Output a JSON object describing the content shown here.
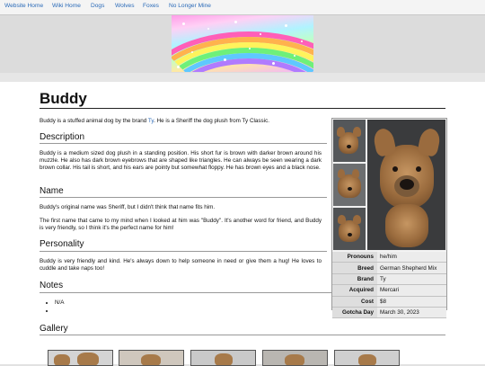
{
  "nav": {
    "items": [
      "Website Home",
      "Wiki Home",
      "Dogs",
      "Wolves",
      "Foxes",
      "No Longer Mine"
    ]
  },
  "page": {
    "title": "Buddy",
    "intro_before": "Buddy is a stuffed animal dog by the brand ",
    "intro_link": "Ty",
    "intro_after": ". He is a Sheriff the dog plush from Ty Classic."
  },
  "sections": {
    "description": {
      "heading": "Description",
      "text": "Buddy is a medium sized dog plush in a standing position. His short fur is brown with darker brown around his muzzle. He also has dark brown eyebrows that are shaped like triangles. He can always be seen wearing a dark brown collar. His tail is short, and his ears are pointy but somewhat floppy. He has brown eyes and a black nose."
    },
    "name": {
      "heading": "Name",
      "text1": "Buddy's original name was Sheriff, but I didn't think that name fits him.",
      "text2": "The first name that came to my mind when I looked at him was \"Buddy\". It's another word for friend, and Buddy is very friendly, so I think it's the perfect name for him!"
    },
    "personality": {
      "heading": "Personality",
      "text": "Buddy is very friendly and kind. He's always down to help someone in need or give them a hug! He loves to cuddle and take naps too!"
    },
    "notes": {
      "heading": "Notes",
      "items": [
        "N/A",
        ""
      ]
    },
    "gallery": {
      "heading": "Gallery"
    }
  },
  "infobox": {
    "rows": [
      {
        "label": "Pronouns",
        "value": "he/him"
      },
      {
        "label": "Breed",
        "value": "German Shepherd Mix"
      },
      {
        "label": "Brand",
        "value": "Ty"
      },
      {
        "label": "Acquired",
        "value": "Mercari"
      },
      {
        "label": "Cost",
        "value": "$8"
      },
      {
        "label": "Gotcha Day",
        "value": "March 30, 2023"
      }
    ]
  },
  "colors": {
    "link": "#2a6ab8",
    "plush_brown": "#a77a4a",
    "photo_background": "#3a3b3d"
  }
}
